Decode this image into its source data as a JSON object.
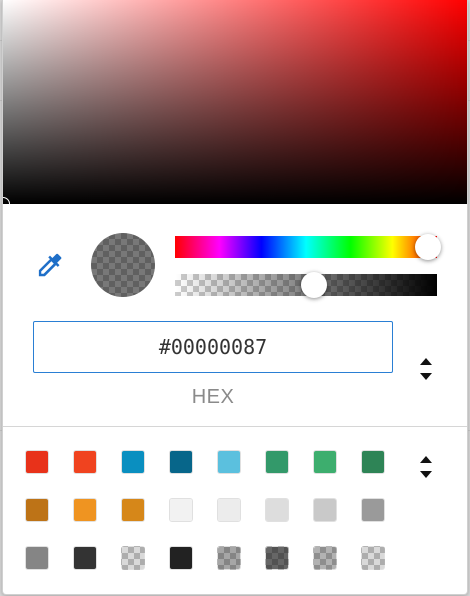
{
  "hex_input": {
    "value": "#00000087"
  },
  "format_label": "HEX",
  "color": {
    "hue": 0,
    "alpha": 0.53,
    "preview": "rgba(0,0,0,0.53)"
  },
  "swatches": [
    {
      "color": "#e8321a",
      "alpha": 1
    },
    {
      "color": "#f0431f",
      "alpha": 1
    },
    {
      "color": "#0a8fc0",
      "alpha": 1
    },
    {
      "color": "#07668a",
      "alpha": 1
    },
    {
      "color": "#5bc0de",
      "alpha": 1
    },
    {
      "color": "#33996a",
      "alpha": 1
    },
    {
      "color": "#3dae6e",
      "alpha": 1
    },
    {
      "color": "#2e8456",
      "alpha": 1
    },
    {
      "color": "#bd7317",
      "alpha": 1
    },
    {
      "color": "#ef9421",
      "alpha": 1
    },
    {
      "color": "#d68719",
      "alpha": 1
    },
    {
      "color": "#f2f2f2",
      "alpha": 1
    },
    {
      "color": "#ececec",
      "alpha": 1
    },
    {
      "color": "#dddddd",
      "alpha": 1
    },
    {
      "color": "#c9c9c9",
      "alpha": 1
    },
    {
      "color": "#9a9a9a",
      "alpha": 1
    },
    {
      "color": "#858585",
      "alpha": 1
    },
    {
      "color": "#333333",
      "alpha": 1
    },
    {
      "color": "#000000",
      "alpha": 0.15
    },
    {
      "color": "#222222",
      "alpha": 1
    },
    {
      "color": "#000000",
      "alpha": 0.35
    },
    {
      "color": "#000000",
      "alpha": 0.6
    },
    {
      "color": "#000000",
      "alpha": 0.3
    },
    {
      "color": "#000000",
      "alpha": 0.15
    }
  ],
  "icons": {
    "eyedropper": "eyedropper-icon",
    "stepper": "up-down-arrows-icon"
  },
  "accent_color": "#2a7fd4"
}
